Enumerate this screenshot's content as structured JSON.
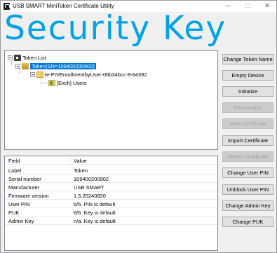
{
  "window": {
    "title": "USB SMART MiniToken Certificate Utility",
    "controls": {
      "minimize": "—",
      "maximize": "☐",
      "close": "✕"
    }
  },
  "brand": {
    "text": "Security Key",
    "color": "#00a2e8"
  },
  "tree": {
    "root": "Token List",
    "token": "Token(SN=109400200902)",
    "container": "te-PIVEnrollmentbyUser-06b34bcc-8-64392",
    "leaf": "[Exch] Users"
  },
  "details": {
    "headers": {
      "field": "Field",
      "value": "Value"
    },
    "rows": [
      {
        "field": "Label",
        "value": "Token"
      },
      {
        "field": "Serial number",
        "value": "109400200902"
      },
      {
        "field": "Manufacturer",
        "value": "USB SMART"
      },
      {
        "field": "Firmware version",
        "value": "1.5.20240820"
      },
      {
        "field": "User PIN",
        "value": "6/6. PIN is default"
      },
      {
        "field": "PUK",
        "value": "6/6. Key is default"
      },
      {
        "field": "Admin Key",
        "value": "n/a. Key is default"
      }
    ]
  },
  "buttons": [
    {
      "label": "Change Token Name",
      "enabled": true
    },
    {
      "label": "Empty Device",
      "enabled": true
    },
    {
      "label": "Initialize",
      "enabled": true
    },
    {
      "label": "Personalize",
      "enabled": false
    },
    {
      "label": "View Certificate",
      "enabled": false
    },
    {
      "label": "Import Certificate",
      "enabled": true
    },
    {
      "label": "Delete Certificate",
      "enabled": false
    },
    {
      "label": "Change User PIN",
      "enabled": true
    },
    {
      "label": "Unblock User PIN",
      "enabled": true
    },
    {
      "label": "Change Admin Key",
      "enabled": true
    },
    {
      "label": "Change PUK",
      "enabled": true
    }
  ]
}
